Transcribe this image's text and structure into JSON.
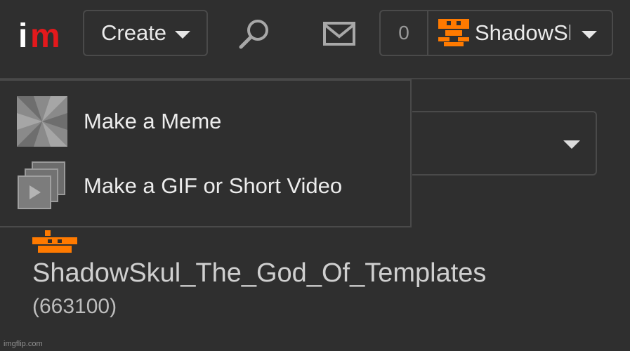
{
  "header": {
    "logo": {
      "letter_i": "i",
      "letter_m": "m"
    },
    "create_label": "Create",
    "search_icon": "search-icon",
    "mail_icon": "mail-icon",
    "notification_count": "0",
    "username_truncated": "ShadowSkul_The_God_Of_Templates"
  },
  "dropdown": {
    "items": [
      {
        "label": "Make a Meme",
        "icon": "meme-image-icon"
      },
      {
        "label": "Make a GIF or Short Video",
        "icon": "gif-video-icon"
      }
    ]
  },
  "profile": {
    "name": "ShadowSkul_The_God_Of_Templates",
    "points": "(663100)"
  },
  "watermark": "imgflip.com",
  "colors": {
    "background": "#2f2f2f",
    "border": "#4a4a4a",
    "logo_red": "#e3191c",
    "avatar_orange": "#ff7a00"
  }
}
